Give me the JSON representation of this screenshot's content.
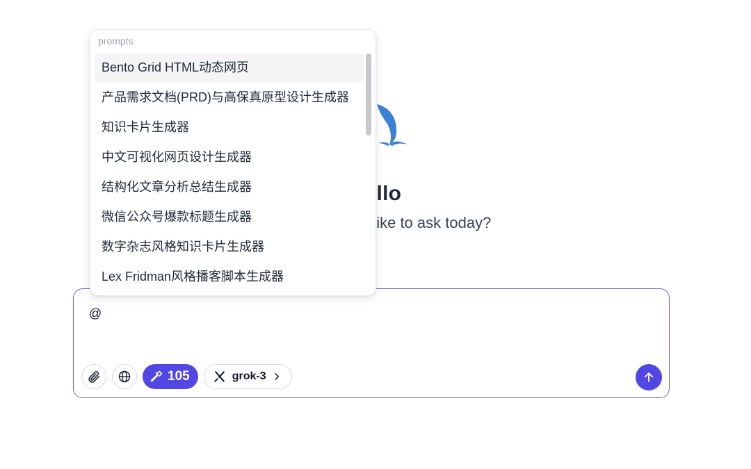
{
  "hero": {
    "greeting": "Hello",
    "subtitle": "What would you like to ask today?"
  },
  "prompts_popup": {
    "header": "prompts",
    "items": [
      {
        "label": "Bento Grid HTML动态网页",
        "active": true
      },
      {
        "label": "产品需求文档(PRD)与高保真原型设计生成器"
      },
      {
        "label": "知识卡片生成器"
      },
      {
        "label": "中文可视化网页设计生成器"
      },
      {
        "label": "结构化文章分析总结生成器"
      },
      {
        "label": "微信公众号爆款标题生成器"
      },
      {
        "label": "数字杂志风格知识卡片生成器"
      },
      {
        "label": "Lex Fridman风格播客脚本生成器"
      }
    ]
  },
  "composer": {
    "input_value": "@",
    "attach_icon": "paperclip-icon",
    "web_icon": "globe-icon",
    "tools": {
      "icon": "hammer-icon",
      "count": "105"
    },
    "model": {
      "icon": "grok-logo-icon",
      "name": "grok-3",
      "chevron": "chevron-right-icon"
    },
    "send_icon": "arrow-up-icon"
  },
  "colors": {
    "accent": "#5147e5",
    "border_focus": "#6d5fd8",
    "logo_blue": "#3b82d6"
  }
}
